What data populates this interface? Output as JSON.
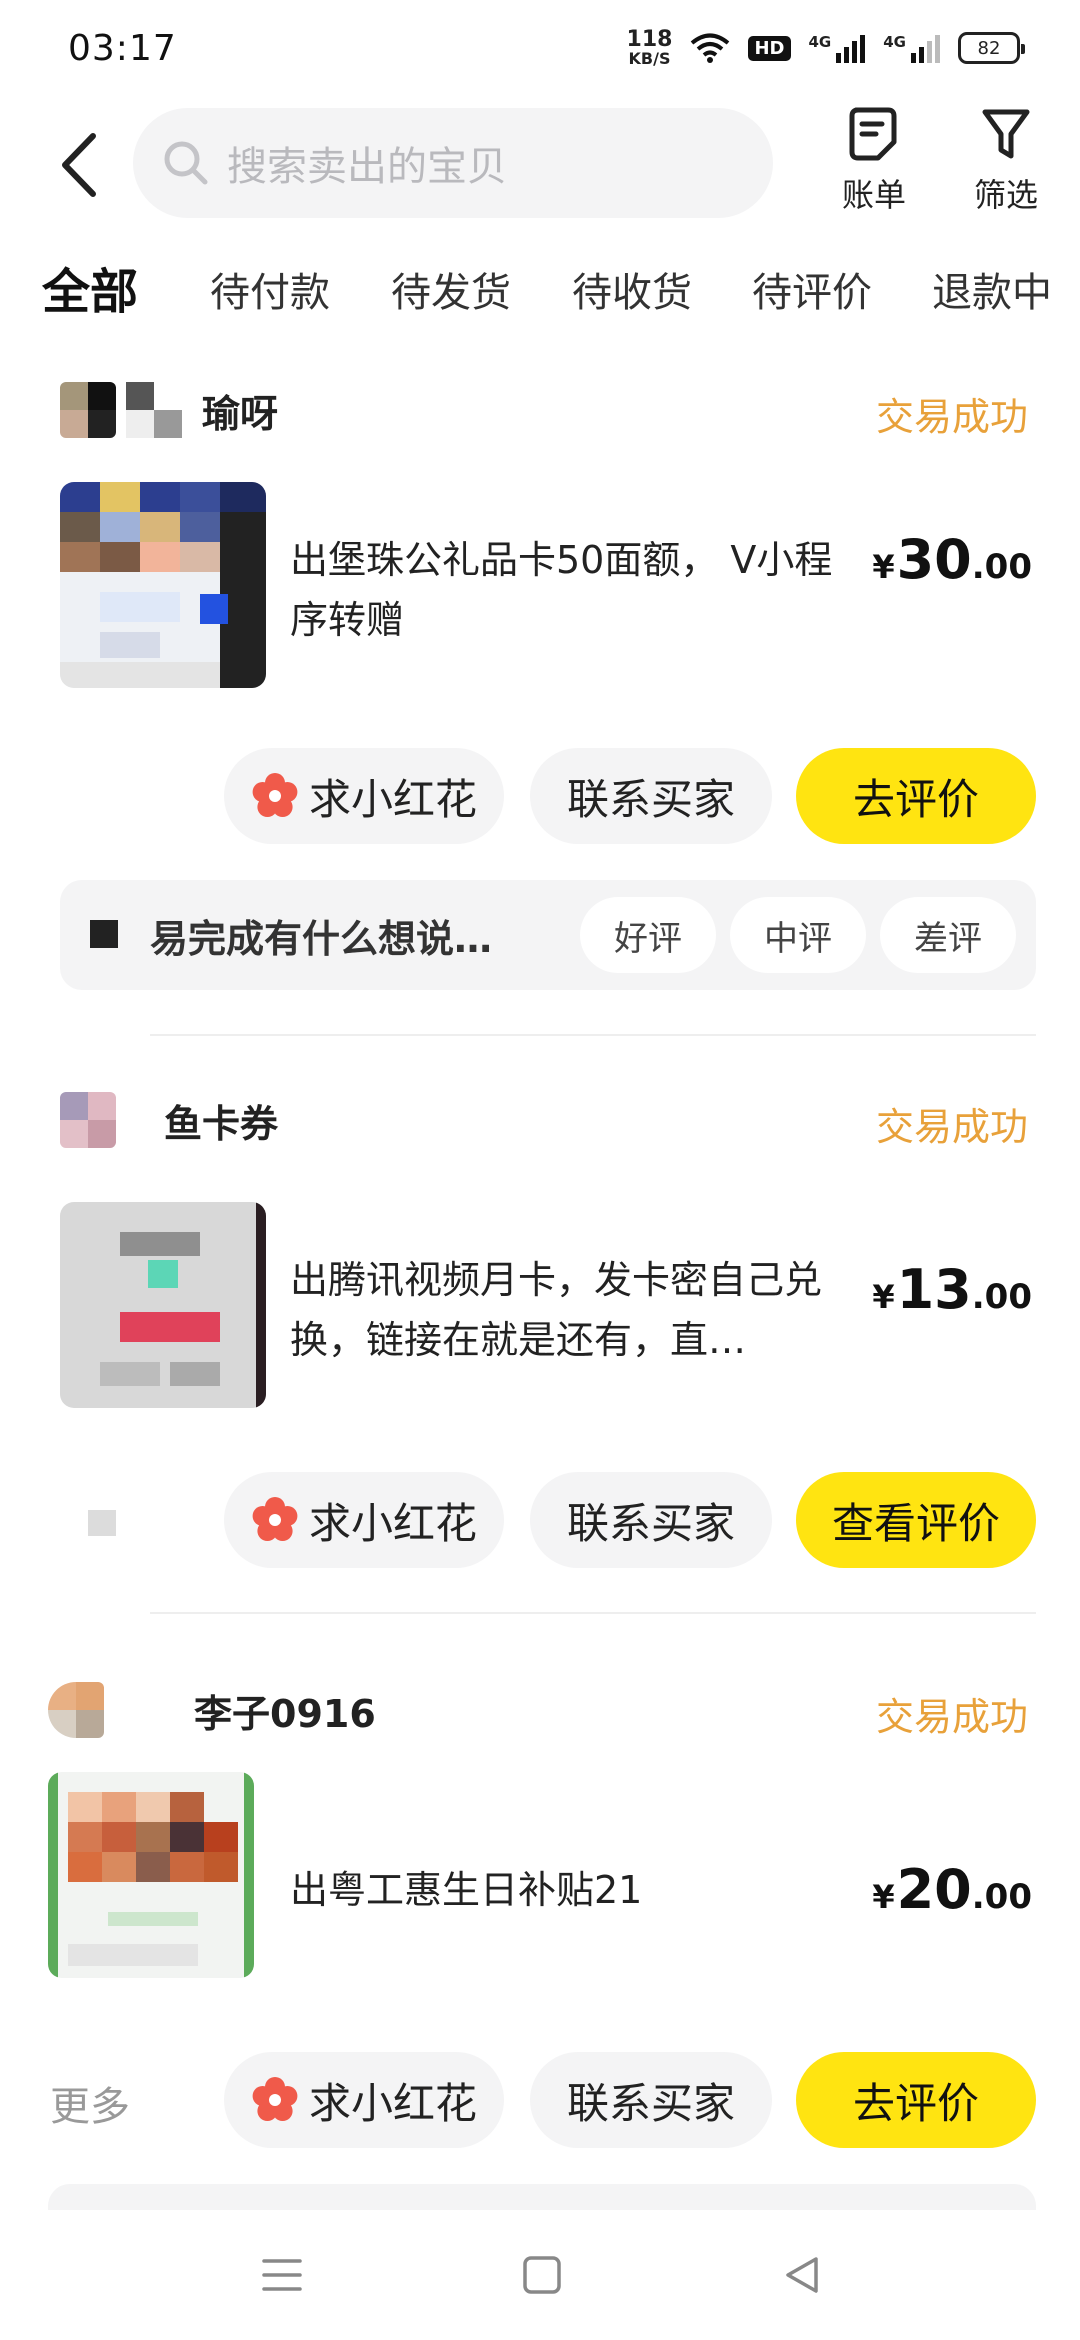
{
  "status_bar": {
    "time": "03:17",
    "net_speed_value": "118",
    "net_speed_unit": "KB/S",
    "hd_label": "HD",
    "signal1_label": "4G",
    "signal2_label": "4G",
    "battery": "82"
  },
  "header": {
    "search_placeholder": "搜索卖出的宝贝",
    "bill_label": "账单",
    "filter_label": "筛选"
  },
  "tabs": [
    {
      "label": "全部",
      "active": true
    },
    {
      "label": "待付款"
    },
    {
      "label": "待发货"
    },
    {
      "label": "待收货"
    },
    {
      "label": "待评价"
    },
    {
      "label": "退款中"
    }
  ],
  "orders": [
    {
      "seller": "瑜呀",
      "status": "交易成功",
      "title": "出堡珠公礼品卡50面额， V小程序转赠",
      "price_int": "30",
      "price_dec": ".00",
      "currency": "¥",
      "flower_label": "求小红花",
      "contact_label": "联系买家",
      "primary_label": "去评价",
      "review_prompt": "易完成有什么想说…",
      "rate_good": "好评",
      "rate_mid": "中评",
      "rate_bad": "差评"
    },
    {
      "seller": "鱼卡券",
      "status": "交易成功",
      "title": "出腾讯视频月卡，发卡密自己兑换，链接在就是还有，直…",
      "price_int": "13",
      "price_dec": ".00",
      "currency": "¥",
      "flower_label": "求小红花",
      "contact_label": "联系买家",
      "primary_label": "查看评价"
    },
    {
      "seller": "李子0916",
      "status": "交易成功",
      "title": "出粤工惠生日补贴21",
      "price_int": "20",
      "price_dec": ".00",
      "currency": "¥",
      "more_label": "更多",
      "flower_label": "求小红花",
      "contact_label": "联系买家",
      "primary_label": "去评价"
    }
  ],
  "icons": {
    "back": "chevron-left-icon",
    "search": "search-icon",
    "bill": "bill-icon",
    "filter": "filter-icon",
    "flower": "flower-icon"
  },
  "colors": {
    "accent_yellow": "#ffe411",
    "status_orange": "#e8a13a",
    "pill_gray": "#f4f4f5",
    "flower_red": "#f05a4a"
  }
}
